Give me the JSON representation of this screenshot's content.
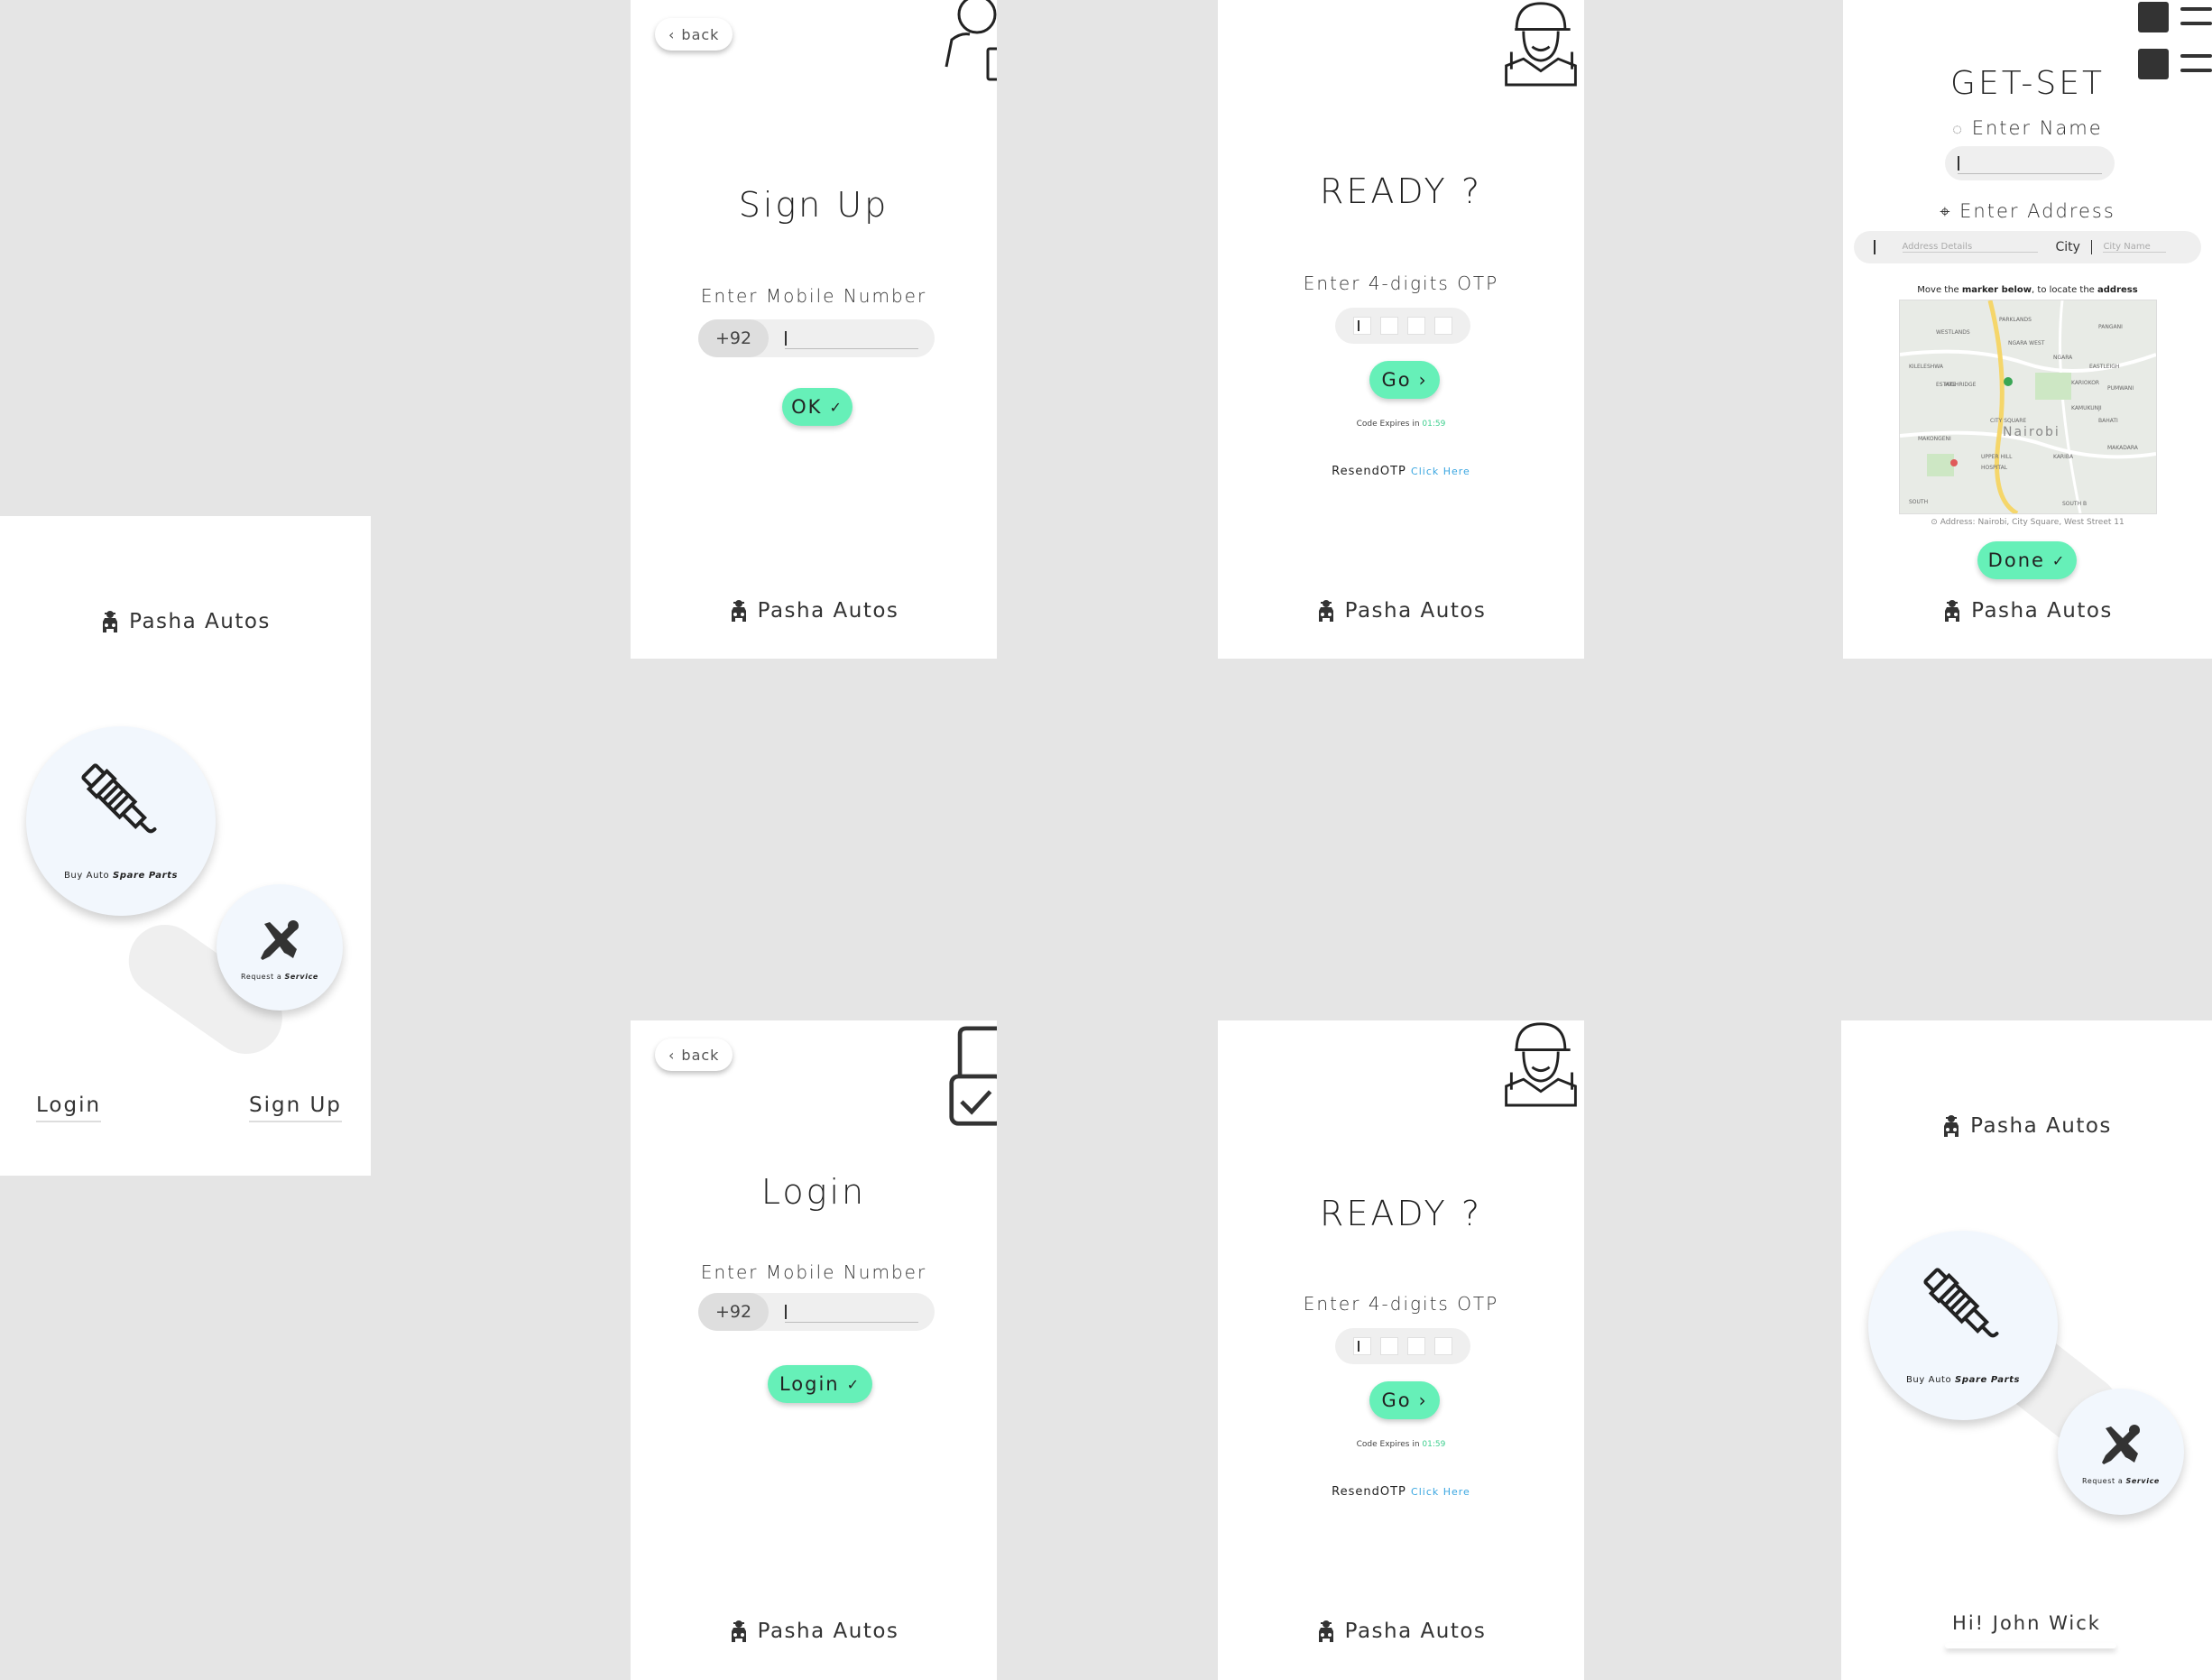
{
  "brand": {
    "name": "Pasha Autos"
  },
  "home": {
    "spare_parts_prefix": "Buy Auto ",
    "spare_parts_bold": "Spare Parts",
    "service_prefix": "Request a ",
    "service_bold": "Service",
    "login_link": "Login",
    "signup_link": "Sign Up",
    "greeting": "Hi! John Wick"
  },
  "signup": {
    "back": "back",
    "title": "Sign Up",
    "mobile_label": "Enter Mobile Number",
    "country_code": "+92",
    "ok_button": "OK"
  },
  "login": {
    "back": "back",
    "title": "Login",
    "mobile_label": "Enter Mobile Number",
    "country_code": "+92",
    "login_button": "Login"
  },
  "otp": {
    "title": "READY ?",
    "label": "Enter 4-digits OTP",
    "go_button": "Go",
    "expires_prefix": "Code Expires in ",
    "expires_time": "01:59",
    "resend_text": "ResendOTP",
    "click_here": "Click Here"
  },
  "getset": {
    "title": "GET-SET",
    "name_label": "Enter Name",
    "address_label": "Enter Address",
    "address_placeholder": "Address Details",
    "city_label": "City",
    "city_placeholder": "City Name",
    "map_hint_1": "Move the ",
    "map_hint_bold1": "marker below",
    "map_hint_2": ", to locate the ",
    "map_hint_bold2": "address",
    "map_city": "Nairobi",
    "map_labels": [
      "WESTLANDS",
      "PARKLANDS",
      "NGARA WEST",
      "NGARA",
      "PANGANI",
      "KILELESHWA",
      "HIGHRIDGE",
      "EASTLEIGH",
      "KARIOKOR",
      "PUMWANI",
      "CITY SQUARE",
      "KAMUKUNJI",
      "BAHATI",
      "UPPER HILL",
      "KARIBA",
      "SOUTH B",
      "MAKONGENI",
      "MAKADARA",
      "HOSPITAL",
      "ESTATE",
      "SOUTH"
    ],
    "address_readout": "Address: Nairobi, City Square, West Street 11",
    "done_button": "Done"
  },
  "colors": {
    "accent": "#66f0b8",
    "link": "#3aa6e0",
    "background": "#e5e5e5"
  }
}
